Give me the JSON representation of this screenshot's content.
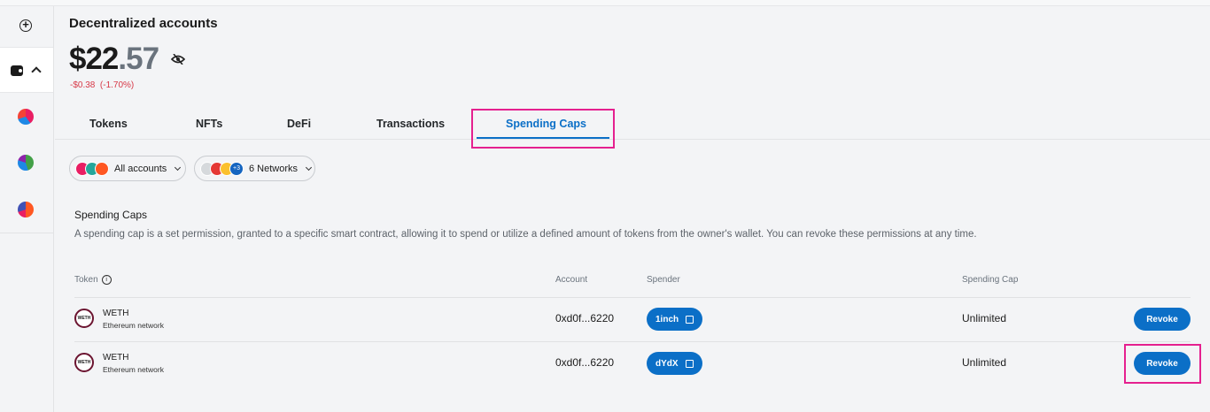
{
  "header": {
    "title": "Decentralized accounts",
    "balance_int": "$22",
    "balance_dec": ".57",
    "change": "-$0.38  (-1.70%)"
  },
  "tabs": [
    {
      "label": "Tokens"
    },
    {
      "label": "NFTs"
    },
    {
      "label": "DeFi"
    },
    {
      "label": "Transactions"
    },
    {
      "label": "Spending Caps"
    }
  ],
  "filters": {
    "accounts": "All accounts",
    "networks_badge": "+3",
    "networks": "6 Networks"
  },
  "section": {
    "title": "Spending Caps",
    "description": "A spending cap is a set permission, granted to a specific smart contract, allowing it to spend or utilize a defined amount of tokens from the owner's wallet. You can revoke these permissions at any time."
  },
  "table": {
    "headers": {
      "token": "Token",
      "account": "Account",
      "spender": "Spender",
      "cap": "Spending Cap"
    },
    "rows": [
      {
        "token": "WETH",
        "network": "Ethereum network",
        "account": "0xd0f...6220",
        "spender": "1inch",
        "cap": "Unlimited",
        "action": "Revoke"
      },
      {
        "token": "WETH",
        "network": "Ethereum network",
        "account": "0xd0f...6220",
        "spender": "dYdX",
        "cap": "Unlimited",
        "action": "Revoke"
      }
    ]
  },
  "colors": {
    "accent": "#0b6fc7",
    "highlight": "#e5208f",
    "negative": "#d73847"
  }
}
